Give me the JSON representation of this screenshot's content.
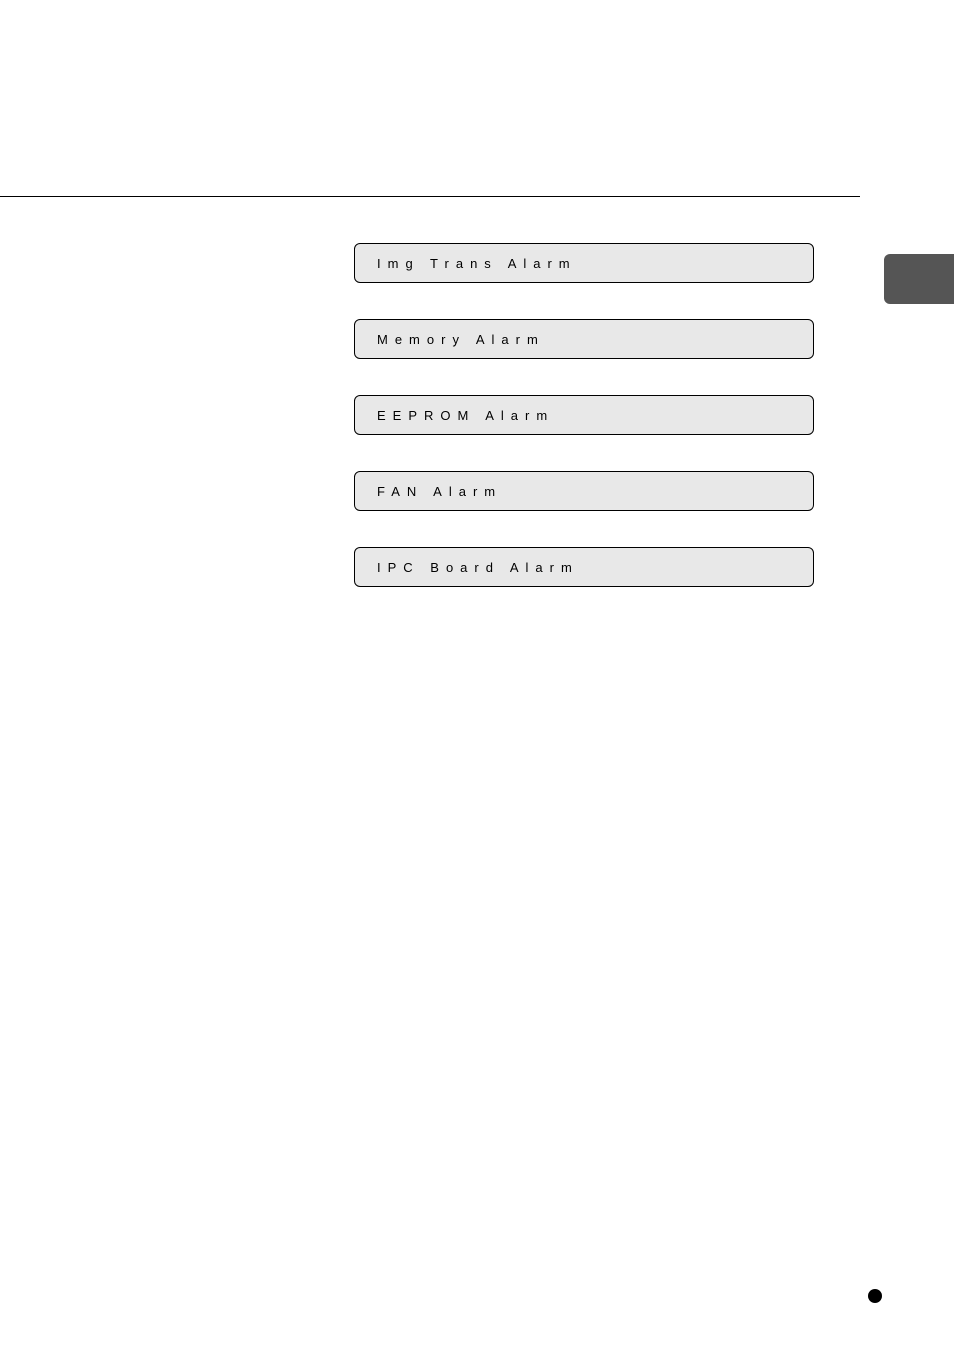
{
  "alarms": {
    "box1": "Img Trans Alarm",
    "box2": "Memory Alarm",
    "box3": "EEPROM Alarm",
    "box4": "FAN Alarm",
    "box5": "IPC Board Alarm"
  }
}
